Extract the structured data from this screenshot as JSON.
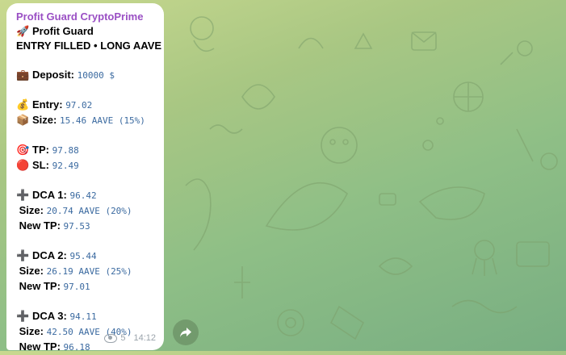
{
  "message": {
    "sender": "Profit Guard CryptoPrime",
    "title": "Profit Guard",
    "title_icon": "rocket-icon",
    "status": "ENTRY FILLED • LONG AAVE",
    "deposit": {
      "label": "Deposit:",
      "value": "10000 $"
    },
    "entry": {
      "label": "Entry:",
      "value": "97.02"
    },
    "size": {
      "label": "Size:",
      "value": "15.46 AAVE (15%)"
    },
    "tp": {
      "label": "TP:",
      "value": "97.88"
    },
    "sl": {
      "label": "SL:",
      "value": "92.49"
    },
    "dca": [
      {
        "label": "DCA 1:",
        "value": "96.42",
        "size_label": "Size:",
        "size": "20.74 AAVE (20%)",
        "newtp_label": "New TP:",
        "newtp": "97.53"
      },
      {
        "label": "DCA 2:",
        "value": "95.44",
        "size_label": "Size:",
        "size": "26.19 AAVE (25%)",
        "newtp_label": "New TP:",
        "newtp": "97.01"
      },
      {
        "label": "DCA 3:",
        "value": "94.11",
        "size_label": "Size:",
        "size": "42.50 AAVE (40%)",
        "newtp_label": "New TP:",
        "newtp": "96.18"
      }
    ],
    "views": "5",
    "time": "14:12"
  },
  "colors": {
    "sender": "#9a4fc4",
    "mono": "#3b6aa0",
    "bg_top": "#c9d98f",
    "bg_bottom": "#78ae82"
  }
}
